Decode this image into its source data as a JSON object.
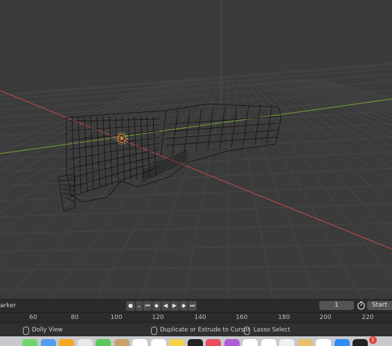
{
  "timeline": {
    "marker_label": "arker",
    "transport_icons": [
      "record-dot-icon",
      "chevron-down-icon",
      "jump-start-icon",
      "keyframe-prev-icon",
      "play-reverse-icon",
      "play-icon",
      "keyframe-next-icon",
      "jump-end-icon"
    ],
    "current_frame": "1",
    "start_label": "Start"
  },
  "ruler": {
    "ticks": [
      "60",
      "80",
      "100",
      "120",
      "140",
      "160",
      "180",
      "200",
      "220"
    ]
  },
  "statusbar": {
    "item1": "Dolly View",
    "item2": "Duplicate or Extrude to Cursor",
    "item3": "Lasso Select"
  },
  "dock": {
    "badge": "1",
    "icon_colors": [
      "#6fd66f",
      "#4f9ef0",
      "#f5a623",
      "#e8e8e8",
      "#5ac85a",
      "#c9a06a",
      "#ffffff",
      "#ffffff",
      "#f6d24a",
      "#222222",
      "#e94d5c",
      "#b05cd8",
      "#ffffff",
      "#ffffff",
      "#f0f0f0",
      "#e6c06a",
      "#ffffff",
      "#2b8ef5",
      "#222222"
    ]
  },
  "colors": {
    "viewport_bg": "#3b3b3b",
    "x_axis": "#c84a4a",
    "y_axis": "#7aa83a",
    "grid": "#4a4a4a"
  }
}
